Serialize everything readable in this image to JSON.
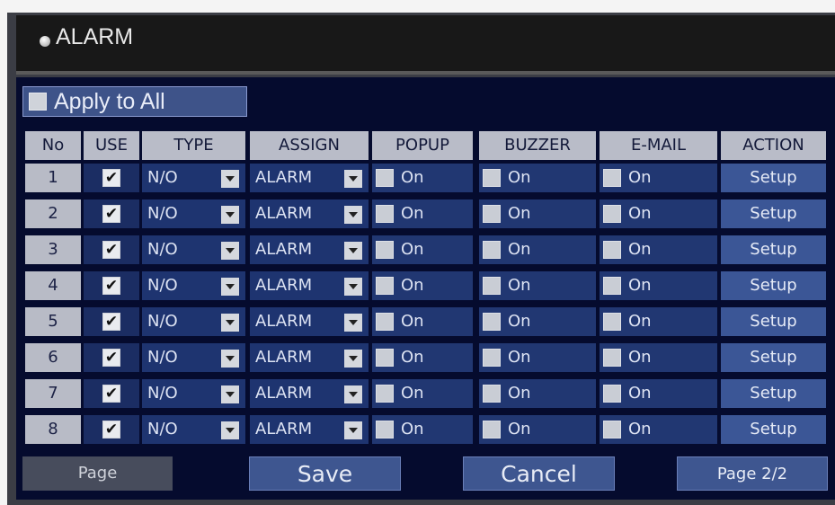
{
  "title": "ALARM",
  "apply_all_label": "Apply to All",
  "columns": [
    "No",
    "USE",
    "TYPE",
    "ASSIGN",
    "POPUP",
    "BUZZER",
    "E-MAIL",
    "ACTION"
  ],
  "rows": [
    {
      "no": "1",
      "use": true,
      "type": "N/O",
      "assign": "ALARM",
      "popup": "On",
      "buzzer": "On",
      "email": "On",
      "action": "Setup"
    },
    {
      "no": "2",
      "use": true,
      "type": "N/O",
      "assign": "ALARM",
      "popup": "On",
      "buzzer": "On",
      "email": "On",
      "action": "Setup"
    },
    {
      "no": "3",
      "use": true,
      "type": "N/O",
      "assign": "ALARM",
      "popup": "On",
      "buzzer": "On",
      "email": "On",
      "action": "Setup"
    },
    {
      "no": "4",
      "use": true,
      "type": "N/O",
      "assign": "ALARM",
      "popup": "On",
      "buzzer": "On",
      "email": "On",
      "action": "Setup"
    },
    {
      "no": "5",
      "use": true,
      "type": "N/O",
      "assign": "ALARM",
      "popup": "On",
      "buzzer": "On",
      "email": "On",
      "action": "Setup"
    },
    {
      "no": "6",
      "use": true,
      "type": "N/O",
      "assign": "ALARM",
      "popup": "On",
      "buzzer": "On",
      "email": "On",
      "action": "Setup"
    },
    {
      "no": "7",
      "use": true,
      "type": "N/O",
      "assign": "ALARM",
      "popup": "On",
      "buzzer": "On",
      "email": "On",
      "action": "Setup"
    },
    {
      "no": "8",
      "use": true,
      "type": "N/O",
      "assign": "ALARM",
      "popup": "On",
      "buzzer": "On",
      "email": "On",
      "action": "Setup"
    }
  ],
  "footer": {
    "page_label": "Page",
    "save_label": "Save",
    "cancel_label": "Cancel",
    "page_indicator": "Page 2/2"
  }
}
